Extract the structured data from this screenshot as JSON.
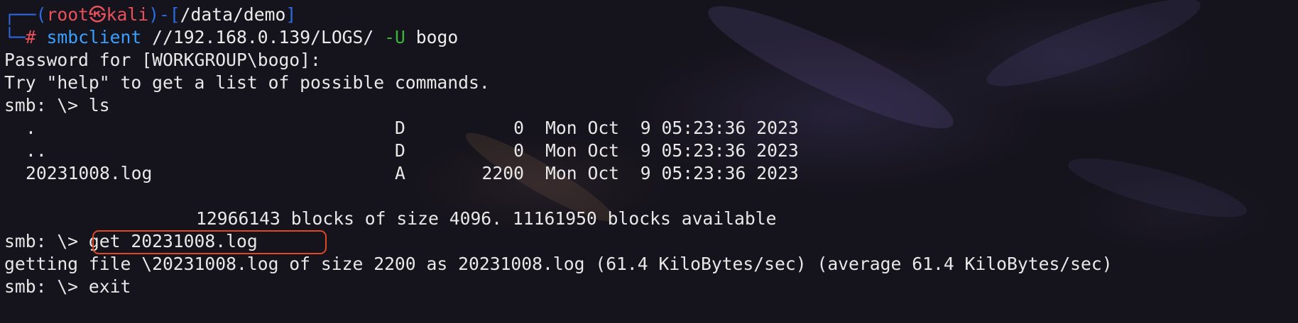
{
  "prompt": {
    "corner_top": "┌──",
    "paren_open": "(",
    "user": "root",
    "at_symbol": "㉿",
    "host": "kali",
    "sep": ")-[",
    "path": "/data/demo",
    "bracket_close": "]",
    "corner_bottom": "└─",
    "hash": "#"
  },
  "command": {
    "program": "smbclient",
    "target": "//192.168.0.139/LOGS/",
    "flag": "-U",
    "user": "bogo"
  },
  "output": {
    "password_prompt": "Password for [WORKGROUP\\bogo]:",
    "help_hint": "Try \"help\" to get a list of possible commands.",
    "smb_prompt_1": "smb: \\> ",
    "ls_cmd": "ls",
    "listing": [
      {
        "name": ".",
        "attr": "D",
        "size": "0",
        "date": "Mon Oct  9 05:23:36 2023"
      },
      {
        "name": "..",
        "attr": "D",
        "size": "0",
        "date": "Mon Oct  9 05:23:36 2023"
      },
      {
        "name": "20231008.log",
        "attr": "A",
        "size": "2200",
        "date": "Mon Oct  9 05:23:36 2023"
      }
    ],
    "blocks_summary": "12966143 blocks of size 4096. 11161950 blocks available",
    "smb_prompt_2": "smb: \\> ",
    "get_cmd": "get 20231008.log",
    "getting_file": "getting file \\20231008.log of size 2200 as 20231008.log (61.4 KiloBytes/sec) (average 61.4 KiloBytes/sec)",
    "smb_prompt_3": "smb: \\> ",
    "exit_cmd": "exit"
  },
  "colors": {
    "prompt_frame": "#2d6be4",
    "prompt_user": "#e8505b",
    "command": "#3aa0ff",
    "flag": "#3cb43c",
    "highlight_box": "#dc4a25"
  }
}
